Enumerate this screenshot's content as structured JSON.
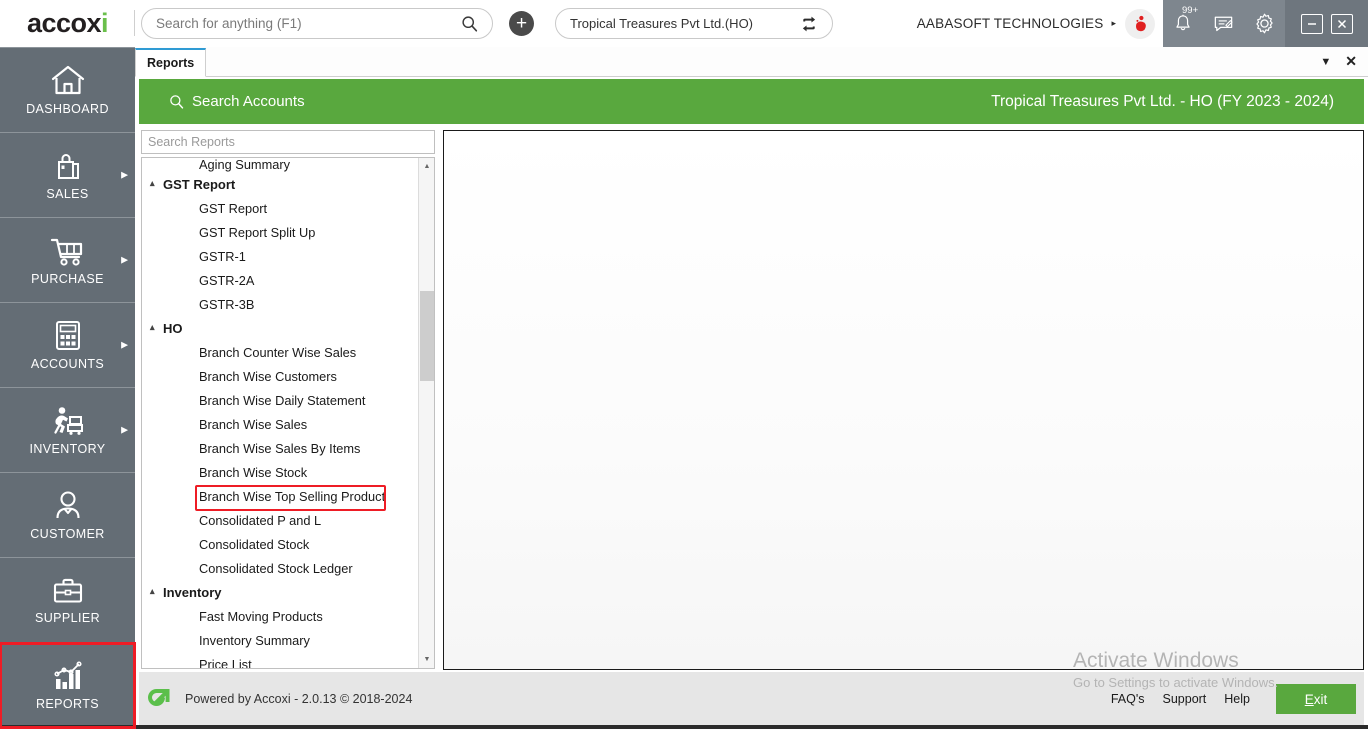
{
  "app": {
    "logo_text": "accox",
    "logo_accent": "i",
    "brand_green": "#6abf4b"
  },
  "topbar": {
    "search_placeholder": "Search for anything (F1)",
    "search_value": "",
    "search_icon": "search-icon",
    "add_button_label": "+",
    "company": "Tropical Treasures Pvt Ltd.(HO)",
    "switch_icon": "switch-company-icon",
    "organization": "AABASOFT TECHNOLOGIES",
    "org_caret": "▸",
    "notification_badge": "99+",
    "notification_icon": "bell-icon",
    "message_icon": "message-icon",
    "settings_icon": "gear-icon",
    "minimize_icon": "minimize-icon",
    "close_icon": "close-icon"
  },
  "sidebar": {
    "items": [
      {
        "label": "DASHBOARD",
        "icon": "home-icon",
        "has_arrow": false,
        "highlighted": false
      },
      {
        "label": "SALES",
        "icon": "shopping-bag-icon",
        "has_arrow": true,
        "highlighted": false
      },
      {
        "label": "PURCHASE",
        "icon": "shopping-cart-icon",
        "has_arrow": true,
        "highlighted": false
      },
      {
        "label": "ACCOUNTS",
        "icon": "calculator-icon",
        "has_arrow": true,
        "highlighted": false
      },
      {
        "label": "INVENTORY",
        "icon": "warehouse-worker-icon",
        "has_arrow": true,
        "highlighted": false
      },
      {
        "label": "CUSTOMER",
        "icon": "person-icon",
        "has_arrow": false,
        "highlighted": false
      },
      {
        "label": "SUPPLIER",
        "icon": "briefcase-icon",
        "has_arrow": false,
        "highlighted": false
      },
      {
        "label": "REPORTS",
        "icon": "bar-chart-icon",
        "has_arrow": false,
        "highlighted": true
      }
    ]
  },
  "tabstrip": {
    "tabs": [
      {
        "label": "Reports",
        "active": true
      }
    ],
    "dropdown_icon": "chevron-down-icon",
    "close_icon": "close-icon"
  },
  "greenbar": {
    "search_icon": "search-icon",
    "title": "Search Accounts",
    "context": "Tropical Treasures Pvt Ltd. - HO (FY 2023 - 2024)",
    "color": "#59a83e"
  },
  "reports": {
    "search_placeholder": "Search Reports",
    "search_value": "",
    "tree": [
      {
        "type": "partial",
        "label": "Aging Summary"
      },
      {
        "type": "group",
        "label": "GST Report",
        "caret": "▴"
      },
      {
        "type": "leaf",
        "label": "GST Report"
      },
      {
        "type": "leaf",
        "label": "GST Report Split Up"
      },
      {
        "type": "leaf",
        "label": "GSTR-1"
      },
      {
        "type": "leaf",
        "label": "GSTR-2A"
      },
      {
        "type": "leaf",
        "label": "GSTR-3B"
      },
      {
        "type": "group",
        "label": "HO",
        "caret": "▴"
      },
      {
        "type": "leaf",
        "label": "Branch Counter Wise Sales"
      },
      {
        "type": "leaf",
        "label": "Branch Wise Customers"
      },
      {
        "type": "leaf",
        "label": "Branch Wise Daily Statement"
      },
      {
        "type": "leaf",
        "label": "Branch Wise Sales"
      },
      {
        "type": "leaf",
        "label": "Branch Wise Sales By Items"
      },
      {
        "type": "leaf",
        "label": "Branch Wise Stock"
      },
      {
        "type": "leaf",
        "label": "Branch Wise Top Selling Product",
        "marked": true
      },
      {
        "type": "leaf",
        "label": "Consolidated P and L"
      },
      {
        "type": "leaf",
        "label": "Consolidated Stock"
      },
      {
        "type": "leaf",
        "label": "Consolidated Stock Ledger"
      },
      {
        "type": "group",
        "label": "Inventory",
        "caret": "▴"
      },
      {
        "type": "leaf",
        "label": "Fast Moving Products"
      },
      {
        "type": "leaf",
        "label": "Inventory Summary"
      },
      {
        "type": "leaf",
        "label": "Price List"
      }
    ],
    "scrollbar": {
      "up_arrow": "▲",
      "down_arrow": "▼"
    },
    "highlight_color": "#ee1c25"
  },
  "watermark": {
    "line1": "Activate Windows",
    "line2": "Go to Settings to activate Windows."
  },
  "footer": {
    "logo_icon": "accoxi-arrow-icon",
    "powered_by": "Powered by Accoxi - 2.0.13 © 2018-2024",
    "links": [
      "FAQ's",
      "Support",
      "Help"
    ],
    "exit_label_pre": "E",
    "exit_label_post": "xit",
    "exit_color": "#59a83e"
  }
}
